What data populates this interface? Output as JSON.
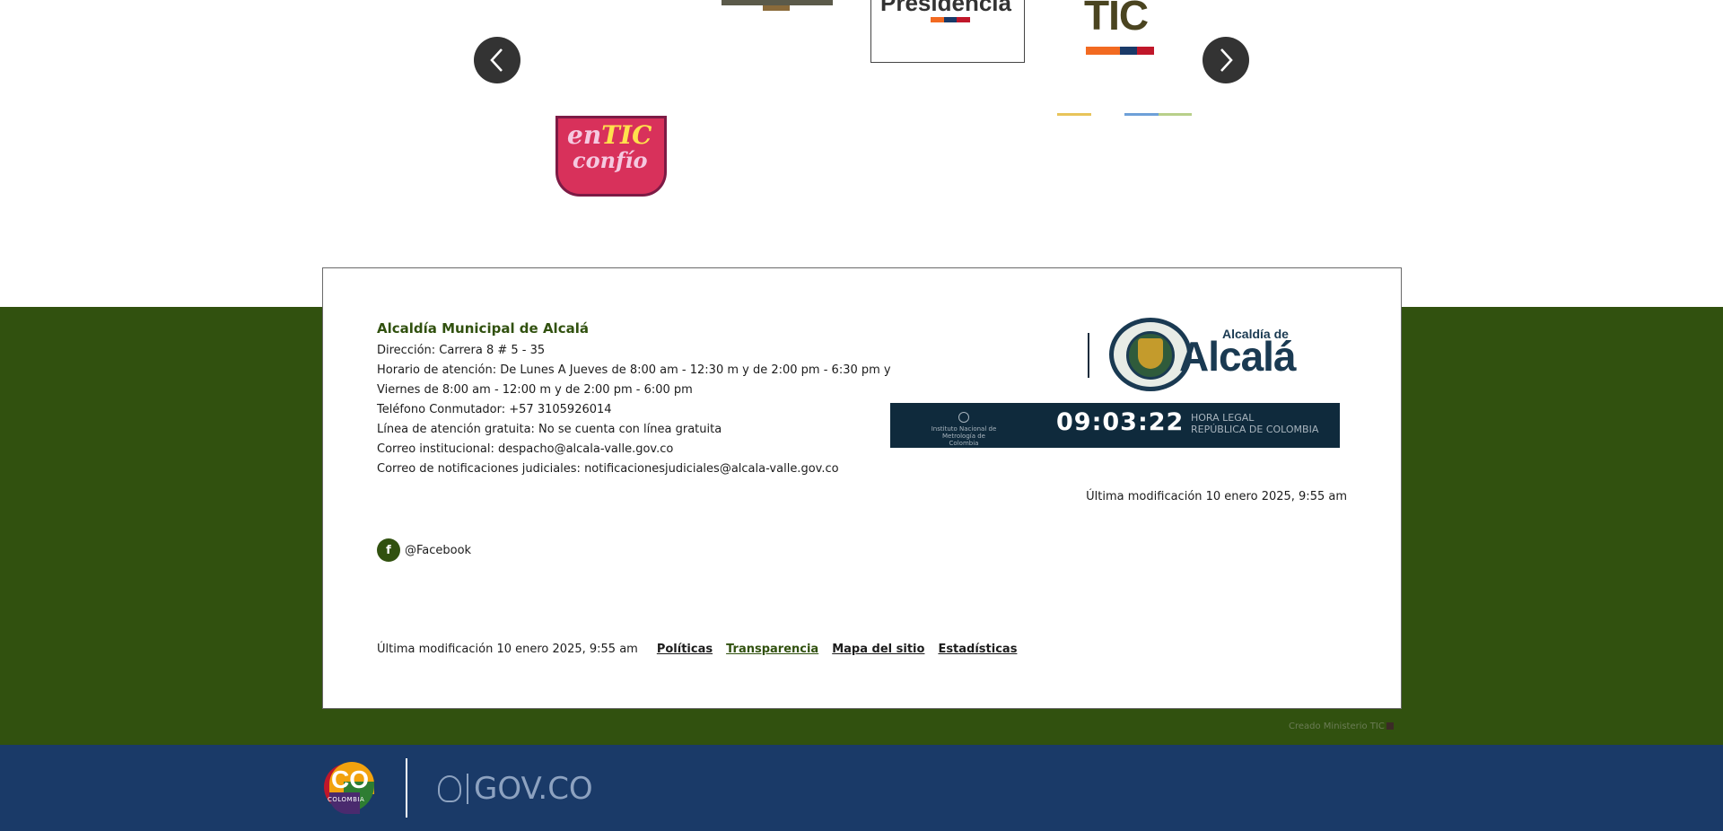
{
  "carousel": {
    "prev_label": "Anterior",
    "next_label": "Siguiente",
    "logos": {
      "presidencia": "Presidencia",
      "tic": "TIC",
      "en_tic": "en",
      "en_tic_highlight": "TIC",
      "confio": "confío"
    }
  },
  "footer": {
    "org_name": "Alcaldía Municipal de Alcalá",
    "lines": [
      "Dirección: Carrera 8 # 5 - 35",
      "Horario de atención: De Lunes A Jueves de 8:00 am - 12:30 m y de 2:00 pm - 6:30 pm y",
      "Viernes de 8:00 am - 12:00 m y de 2:00 pm - 6:00 pm",
      "Teléfono Conmutador: +57 3105926014",
      "Línea de atención gratuita: No se cuenta con línea gratuita",
      "Correo institucional: despacho@alcala-valle.gov.co",
      "Correo de notificaciones judiciales: notificacionesjudiciales@alcala-valle.gov.co"
    ],
    "facebook_icon_letter": "f",
    "facebook_label": "@Facebook",
    "last_modified": "Última modificación 10 enero 2025, 9:55 am",
    "links": [
      "Políticas",
      "Transparencia",
      "Mapa del sitio",
      "Estadísticas"
    ],
    "logo": {
      "small": "Alcaldía de",
      "big": "Alcalá"
    },
    "clock": {
      "time": "09:03:22",
      "inm_line1": "Instituto Nacional de",
      "inm_line2": "Metrología de Colombia",
      "label_line1": "HORA LEGAL",
      "label_line2": "REPÚBLICA DE COLOMBIA"
    },
    "created_by": "Creado Ministerio TIC"
  },
  "gov_bar": {
    "co_text": "CO",
    "colombia_text": "COLOMBIA",
    "gov_text": "GOV.CO"
  },
  "colors": {
    "brand_green": "#31510f",
    "gov_blue": "#1a3a68",
    "clock_bg": "#0f2a3c",
    "stripe_orange": "#f26a21",
    "stripe_navy": "#1a3a68",
    "stripe_red": "#c0172a"
  }
}
